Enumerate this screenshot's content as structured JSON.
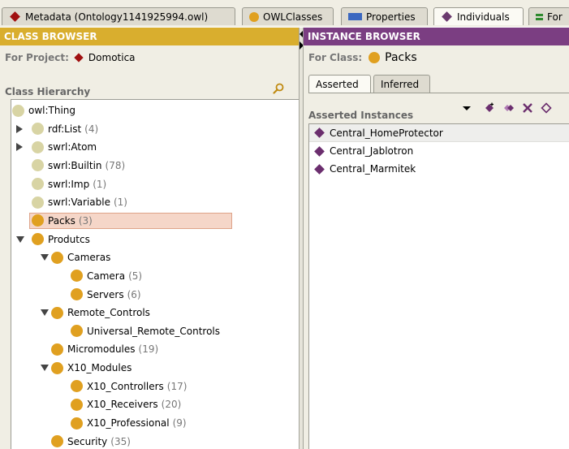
{
  "tabs": [
    {
      "label": "Metadata (Ontology1141925994.owl)",
      "icon": "metadata-diamond-icon",
      "active": false
    },
    {
      "label": "OWLClasses",
      "icon": "class-circle-icon",
      "active": false
    },
    {
      "label": "Properties",
      "icon": "property-rect-icon",
      "active": false
    },
    {
      "label": "Individuals",
      "icon": "individual-diamond-icon",
      "active": true
    },
    {
      "label": "For",
      "icon": "forms-icon",
      "active": false
    }
  ],
  "class_browser": {
    "title": "CLASS BROWSER",
    "for_project_label": "For Project:",
    "project_name": "Domotica",
    "hierarchy_label": "Class Hierarchy",
    "tree": [
      {
        "label": "owl:Thing",
        "count": "",
        "indent": 0,
        "expander": "none",
        "icon": "light"
      },
      {
        "label": "rdf:List",
        "count": "(4)",
        "indent": 1,
        "expander": "collapsed",
        "icon": "light"
      },
      {
        "label": "swrl:Atom",
        "count": "",
        "indent": 1,
        "expander": "collapsed",
        "icon": "light"
      },
      {
        "label": "swrl:Builtin",
        "count": "(78)",
        "indent": 1,
        "expander": "none",
        "icon": "light"
      },
      {
        "label": "swrl:Imp",
        "count": "(1)",
        "indent": 1,
        "expander": "none",
        "icon": "light"
      },
      {
        "label": "swrl:Variable",
        "count": "(1)",
        "indent": 1,
        "expander": "none",
        "icon": "light"
      },
      {
        "label": "Packs",
        "count": "(3)",
        "indent": 1,
        "expander": "none",
        "icon": "gold",
        "selected": true
      },
      {
        "label": "Produtcs",
        "count": "",
        "indent": 1,
        "expander": "expanded",
        "icon": "gold"
      },
      {
        "label": "Cameras",
        "count": "",
        "indent": 2,
        "expander": "expanded",
        "icon": "gold"
      },
      {
        "label": "Camera",
        "count": "(5)",
        "indent": 3,
        "expander": "none",
        "icon": "gold"
      },
      {
        "label": "Servers",
        "count": "(6)",
        "indent": 3,
        "expander": "none",
        "icon": "gold"
      },
      {
        "label": "Remote_Controls",
        "count": "",
        "indent": 2,
        "expander": "expanded",
        "icon": "gold"
      },
      {
        "label": "Universal_Remote_Controls",
        "count": "",
        "indent": 3,
        "expander": "none",
        "icon": "gold"
      },
      {
        "label": "Micromodules",
        "count": "(19)",
        "indent": 2,
        "expander": "none",
        "icon": "gold"
      },
      {
        "label": "X10_Modules",
        "count": "",
        "indent": 2,
        "expander": "expanded",
        "icon": "gold"
      },
      {
        "label": "X10_Controllers",
        "count": "(17)",
        "indent": 3,
        "expander": "none",
        "icon": "gold"
      },
      {
        "label": "X10_Receivers",
        "count": "(20)",
        "indent": 3,
        "expander": "none",
        "icon": "gold"
      },
      {
        "label": "X10_Professional",
        "count": "(9)",
        "indent": 3,
        "expander": "none",
        "icon": "gold"
      },
      {
        "label": "Security",
        "count": "(35)",
        "indent": 2,
        "expander": "none",
        "icon": "gold"
      }
    ]
  },
  "instance_browser": {
    "title": "INSTANCE BROWSER",
    "for_class_label": "For Class:",
    "class_name": "Packs",
    "subtabs": [
      {
        "label": "Asserted",
        "active": true
      },
      {
        "label": "Inferred",
        "active": false
      }
    ],
    "list_label": "Asserted Instances",
    "instances": [
      "Central_HomeProtector",
      "Central_Jablotron",
      "Central_Marmitek"
    ]
  },
  "colors": {
    "class_header": "#d9ae2e",
    "instance_header": "#7b3e82",
    "class_icon": "#e0a020",
    "instance_icon": "#6b2e6e"
  }
}
